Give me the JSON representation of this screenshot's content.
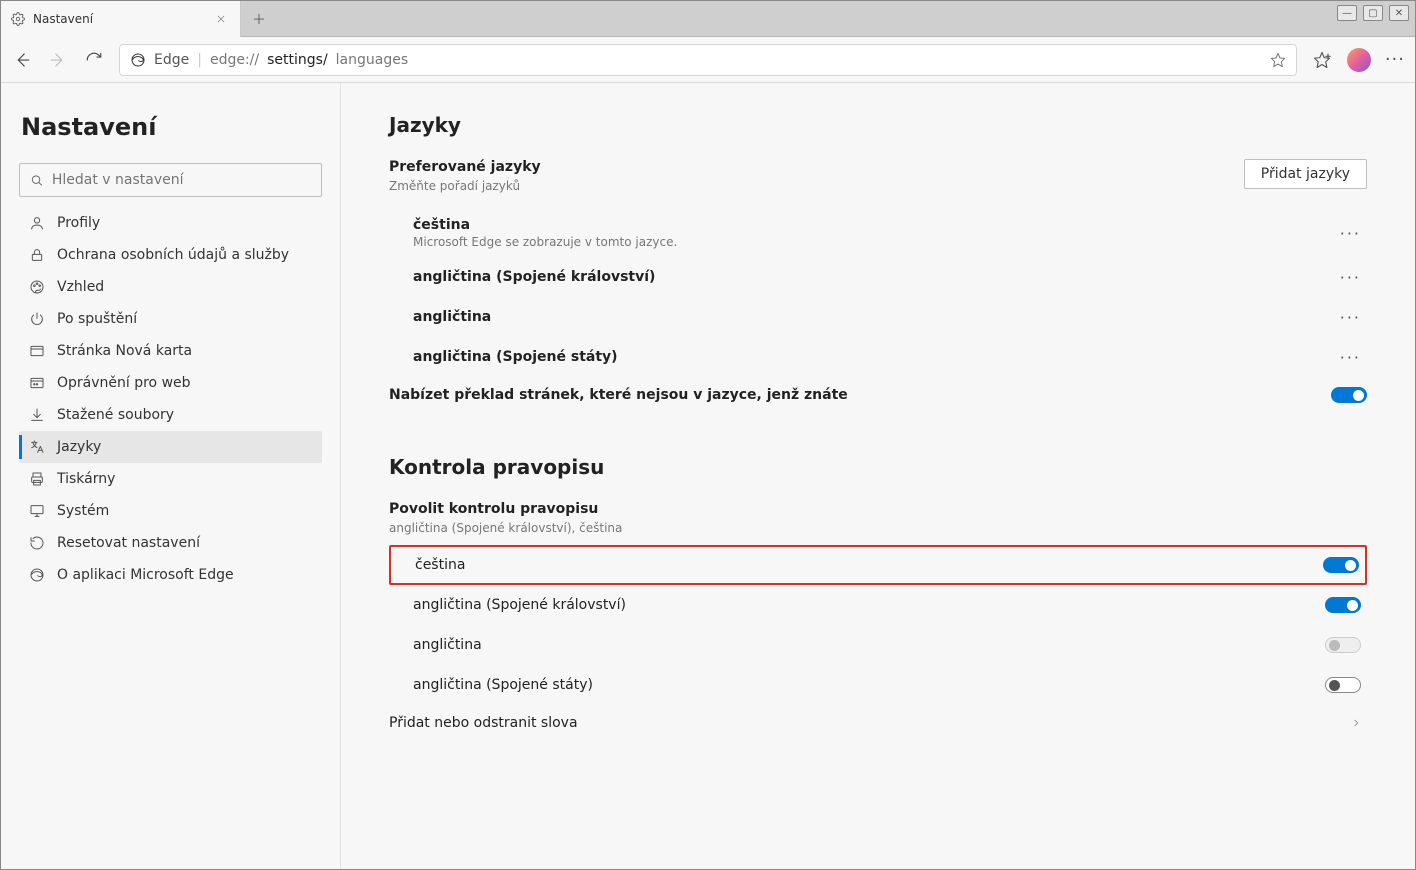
{
  "browser": {
    "tab_title": "Nastavení",
    "app_name": "Edge",
    "url_prefix": "edge://",
    "url_segment": "settings/",
    "url_page": "languages"
  },
  "sidebar": {
    "title": "Nastavení",
    "search_placeholder": "Hledat v nastavení",
    "items": {
      "0": {
        "label": "Profily"
      },
      "1": {
        "label": "Ochrana osobních údajů a služby"
      },
      "2": {
        "label": "Vzhled"
      },
      "3": {
        "label": "Po spuštění"
      },
      "4": {
        "label": "Stránka Nová karta"
      },
      "5": {
        "label": "Oprávnění pro web"
      },
      "6": {
        "label": "Stažené soubory"
      },
      "7": {
        "label": "Jazyky"
      },
      "8": {
        "label": "Tiskárny"
      },
      "9": {
        "label": "Systém"
      },
      "10": {
        "label": "Resetovat nastavení"
      },
      "11": {
        "label": "O aplikaci Microsoft Edge"
      }
    }
  },
  "languages": {
    "heading": "Jazyky",
    "preferred_title": "Preferované jazyky",
    "preferred_subtitle": "Změňte pořadí jazyků",
    "add_button": "Přidat jazyky",
    "list": {
      "0": {
        "name": "čeština",
        "desc": "Microsoft Edge se zobrazuje v tomto jazyce."
      },
      "1": {
        "name": "angličtina (Spojené království)"
      },
      "2": {
        "name": "angličtina"
      },
      "3": {
        "name": "angličtina (Spojené státy)"
      }
    },
    "translate_label": "Nabízet překlad stránek, které nejsou v jazyce, jenž znáte"
  },
  "spellcheck": {
    "heading": "Kontrola pravopisu",
    "enable_title": "Povolit kontrolu pravopisu",
    "enable_subtitle": "angličtina (Spojené království), čeština",
    "list": {
      "0": {
        "name": "čeština"
      },
      "1": {
        "name": "angličtina (Spojené království)"
      },
      "2": {
        "name": "angličtina"
      },
      "3": {
        "name": "angličtina (Spojené státy)"
      }
    },
    "add_remove_words": "Přidat nebo odstranit slova"
  }
}
